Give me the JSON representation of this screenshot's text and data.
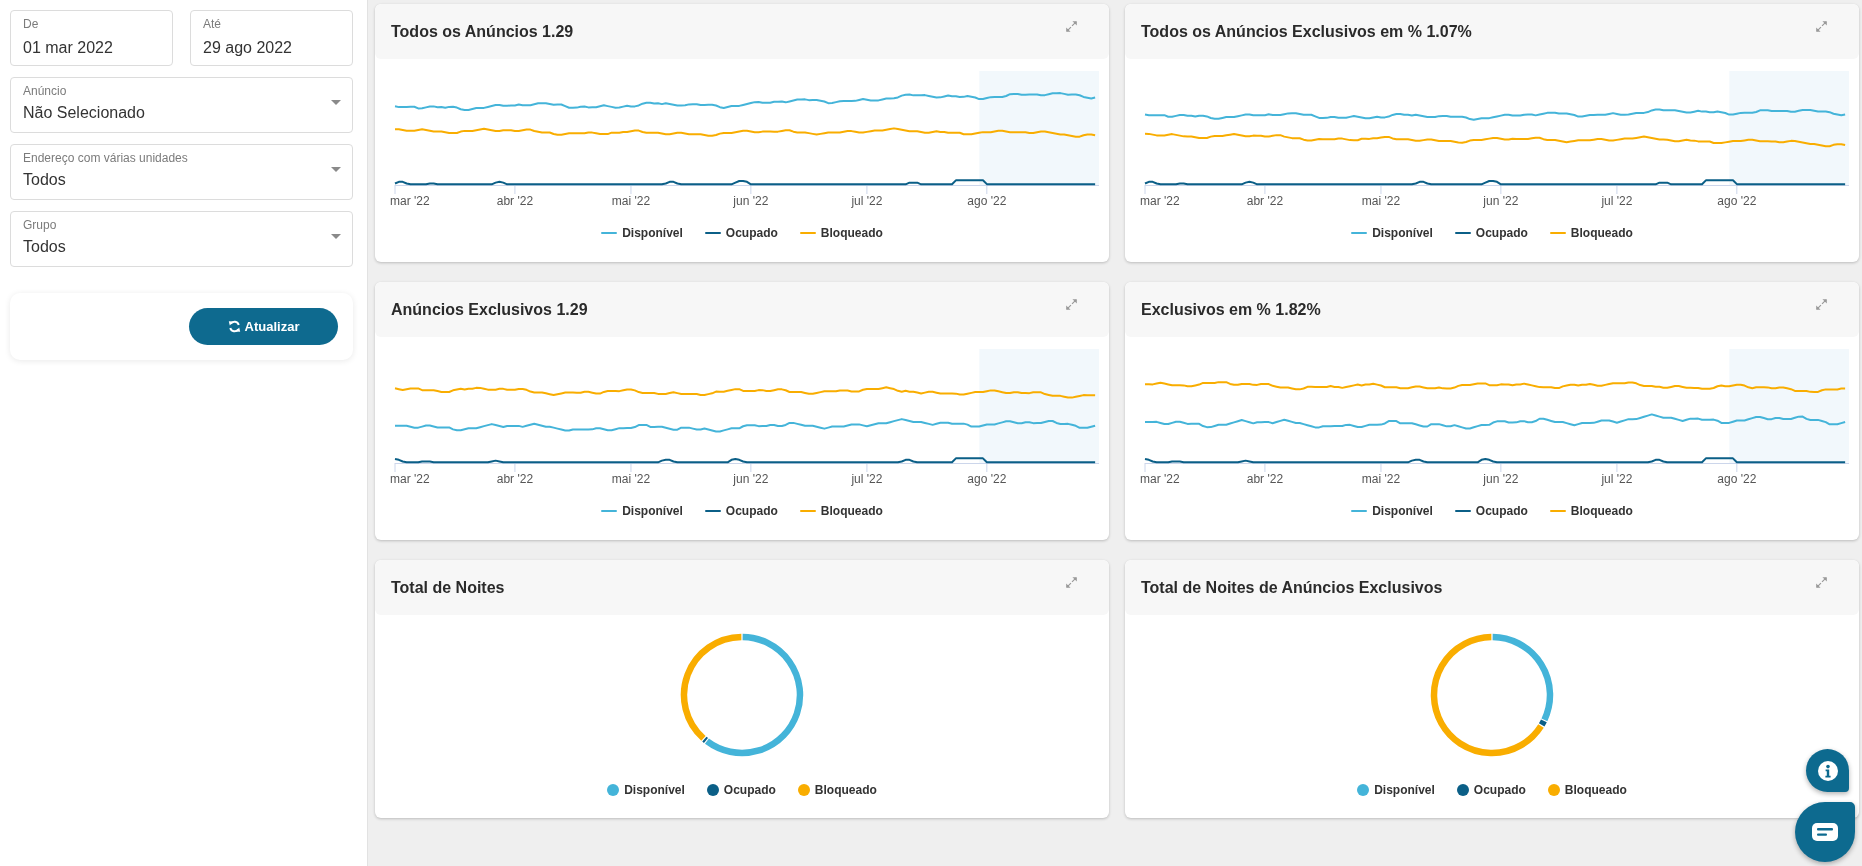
{
  "sidebar": {
    "date_from": {
      "label": "De",
      "value": "01 mar 2022"
    },
    "date_to": {
      "label": "Até",
      "value": "29 ago 2022"
    },
    "selects": [
      {
        "label": "Anúncio",
        "value": "Não Selecionado"
      },
      {
        "label": "Endereço com várias unidades",
        "value": "Todos"
      },
      {
        "label": "Grupo",
        "value": "Todos"
      }
    ],
    "refresh_button": {
      "label": "Atualizar"
    }
  },
  "panels": [
    {
      "kind": "line",
      "title": "Todos os Anúncios 1.29",
      "x_labels": [
        "mar '22",
        "abr '22",
        "mai '22",
        "jun '22",
        "jul '22",
        "ago '22"
      ],
      "legend": [
        {
          "label": "Disponível",
          "color": "#44b4d9"
        },
        {
          "label": "Ocupado",
          "color": "#0b5f87"
        },
        {
          "label": "Bloqueado",
          "color": "#f9ad00"
        }
      ]
    },
    {
      "kind": "line",
      "title": "Todos os Anúncios Exclusivos em % 1.07%",
      "x_labels": [
        "mar '22",
        "abr '22",
        "mai '22",
        "jun '22",
        "jul '22",
        "ago '22"
      ],
      "legend": [
        {
          "label": "Disponível",
          "color": "#44b4d9"
        },
        {
          "label": "Ocupado",
          "color": "#0b5f87"
        },
        {
          "label": "Bloqueado",
          "color": "#f9ad00"
        }
      ]
    },
    {
      "kind": "line",
      "title": "Anúncios Exclusivos 1.29",
      "x_labels": [
        "mar '22",
        "abr '22",
        "mai '22",
        "jun '22",
        "jul '22",
        "ago '22"
      ],
      "legend": [
        {
          "label": "Disponível",
          "color": "#44b4d9"
        },
        {
          "label": "Ocupado",
          "color": "#0b5f87"
        },
        {
          "label": "Bloqueado",
          "color": "#f9ad00"
        }
      ]
    },
    {
      "kind": "line",
      "title": "Exclusivos em % 1.82%",
      "x_labels": [
        "mar '22",
        "abr '22",
        "mai '22",
        "jun '22",
        "jul '22",
        "ago '22"
      ],
      "legend": [
        {
          "label": "Disponível",
          "color": "#44b4d9"
        },
        {
          "label": "Ocupado",
          "color": "#0b5f87"
        },
        {
          "label": "Bloqueado",
          "color": "#f9ad00"
        }
      ]
    },
    {
      "kind": "donut",
      "title": "Total de Noites",
      "legend": [
        {
          "label": "Disponível",
          "color": "#44b4d9"
        },
        {
          "label": "Ocupado",
          "color": "#0b5f87"
        },
        {
          "label": "Bloqueado",
          "color": "#f9ad00"
        }
      ]
    },
    {
      "kind": "donut",
      "title": "Total de Noites de Anúncios Exclusivos",
      "legend": [
        {
          "label": "Disponível",
          "color": "#44b4d9"
        },
        {
          "label": "Ocupado",
          "color": "#0b5f87"
        },
        {
          "label": "Bloqueado",
          "color": "#f9ad00"
        }
      ]
    }
  ]
}
